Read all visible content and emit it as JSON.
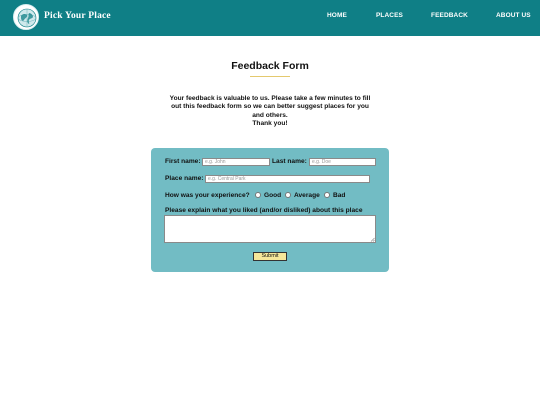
{
  "header": {
    "brand": "Pick Your Place",
    "nav": [
      "HOME",
      "PLACES",
      "FEEDBACK",
      "ABOUT US"
    ]
  },
  "page": {
    "title": "Feedback Form",
    "intro_lines": [
      "Your feedback is valuable to us. Please take a few minutes to fill",
      "out this feedback form so we can better suggest places for you",
      "and others.",
      "Thank you!"
    ]
  },
  "form": {
    "first_name_label": "First name:",
    "first_name_placeholder": "e.g. John",
    "first_name_value": "",
    "last_name_label": "Last name:",
    "last_name_placeholder": "e.g. Doe",
    "last_name_value": "",
    "place_label": "Place name:",
    "place_placeholder": "e.g. Central Park",
    "place_value": "",
    "experience_label": "How was your experience?",
    "experience_options": [
      "Good",
      "Average",
      "Bad"
    ],
    "explain_label": "Please explain what you liked (and/or disliked) about this place",
    "explain_value": "",
    "submit_label": "Submit"
  },
  "colors": {
    "nav_background": "#0f7f86",
    "form_background": "#72bcc4",
    "title_underline": "#e4c96e",
    "submit_background": "#f6e79a"
  },
  "icons": {
    "logo": "globe-logo-icon",
    "resize": "resize-grip-icon"
  }
}
